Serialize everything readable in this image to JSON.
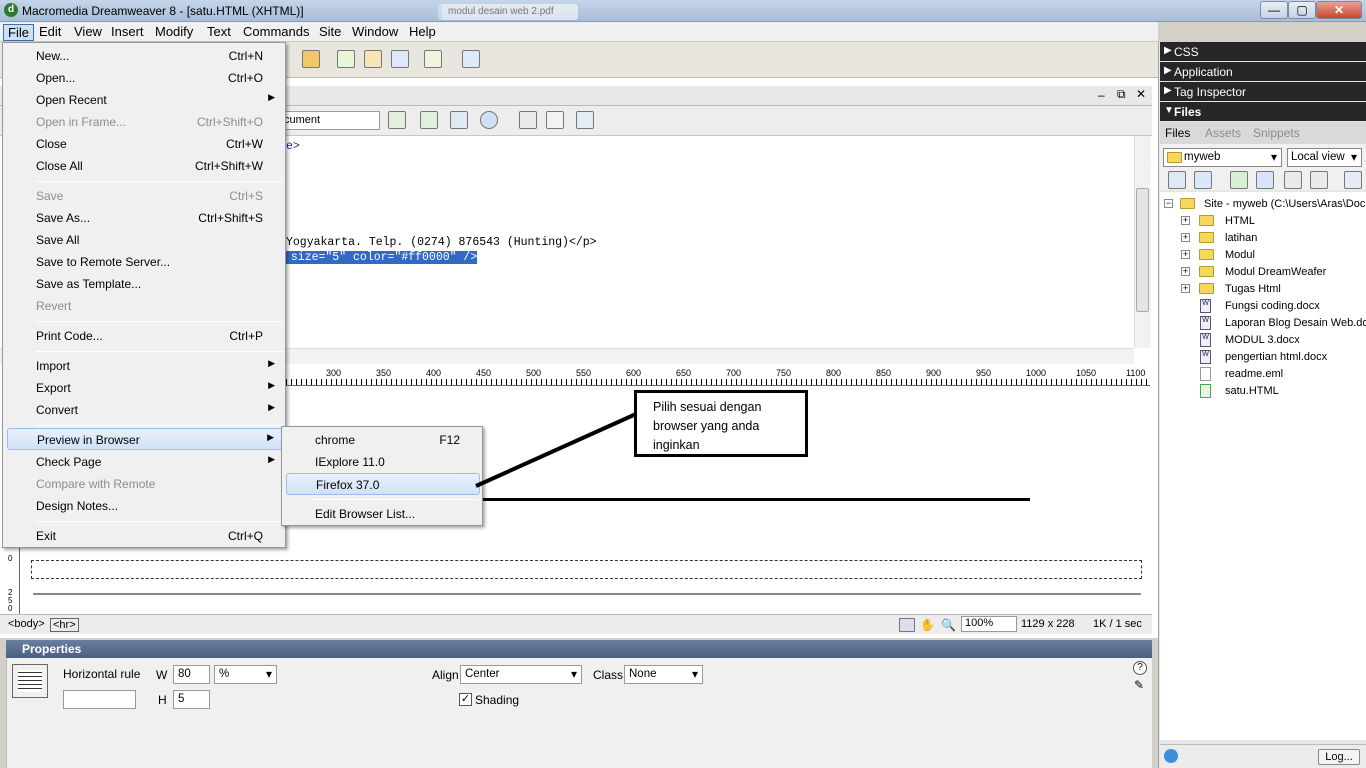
{
  "window": {
    "title": "Macromedia Dreamweaver 8 - [satu.HTML (XHTML)]",
    "bg_tab_1": "",
    "bg_tab_2": "modul desain web 2.pdf",
    "minimize": "—",
    "maximize": "▢",
    "close": "✕"
  },
  "menubar": [
    "File",
    "Edit",
    "View",
    "Insert",
    "Modify",
    "Text",
    "Commands",
    "Site",
    "Window",
    "Help"
  ],
  "document": {
    "title_value": "cument",
    "code_lines": [
      {
        "text": "e>"
      },
      {
        "text": "Yogyakarta. Telp. (0274) 876543 (Hunting)</p>"
      },
      {
        "text": " size=\"5\" color=\"#ff0000\" />"
      }
    ],
    "ruler_labels": [
      "300",
      "350",
      "400",
      "450",
      "500",
      "550",
      "600",
      "650",
      "700",
      "750",
      "800",
      "850",
      "900",
      "950",
      "1000",
      "1050",
      "1100"
    ],
    "vruler": [
      "0",
      "2",
      "5",
      "0"
    ]
  },
  "statusbar": {
    "tag_body": "<body>",
    "tag_hr": "<hr>",
    "zoom": "100%",
    "size": "1129 x 228",
    "download": "1K / 1 sec"
  },
  "properties": {
    "header": "Properties",
    "element": "Horizontal rule",
    "w_label": "W",
    "w_value": "80",
    "w_unit": "%",
    "h_label": "H",
    "h_value": "5",
    "align_label": "Align",
    "align_value": "Center",
    "class_label": "Class",
    "class_value": "None",
    "shading_label": "Shading",
    "shading_checked": "✓",
    "help": "?"
  },
  "file_menu": {
    "items": [
      {
        "label": "New...",
        "shortcut": "Ctrl+N",
        "disabled": false,
        "submenu": false
      },
      {
        "label": "Open...",
        "shortcut": "Ctrl+O",
        "disabled": false,
        "submenu": false
      },
      {
        "label": "Open Recent",
        "shortcut": "",
        "disabled": false,
        "submenu": true
      },
      {
        "label": "Open in Frame...",
        "shortcut": "Ctrl+Shift+O",
        "disabled": true,
        "submenu": false
      },
      {
        "label": "Close",
        "shortcut": "Ctrl+W",
        "disabled": false,
        "submenu": false
      },
      {
        "label": "Close All",
        "shortcut": "Ctrl+Shift+W",
        "disabled": false,
        "submenu": false
      },
      {
        "label": "Save",
        "shortcut": "Ctrl+S",
        "disabled": true,
        "submenu": false
      },
      {
        "label": "Save As...",
        "shortcut": "Ctrl+Shift+S",
        "disabled": false,
        "submenu": false
      },
      {
        "label": "Save All",
        "shortcut": "",
        "disabled": false,
        "submenu": false
      },
      {
        "label": "Save to Remote Server...",
        "shortcut": "",
        "disabled": false,
        "submenu": false
      },
      {
        "label": "Save as Template...",
        "shortcut": "",
        "disabled": false,
        "submenu": false
      },
      {
        "label": "Revert",
        "shortcut": "",
        "disabled": true,
        "submenu": false
      },
      {
        "label": "Print Code...",
        "shortcut": "Ctrl+P",
        "disabled": false,
        "submenu": false
      },
      {
        "label": "Import",
        "shortcut": "",
        "disabled": false,
        "submenu": true
      },
      {
        "label": "Export",
        "shortcut": "",
        "disabled": false,
        "submenu": true
      },
      {
        "label": "Convert",
        "shortcut": "",
        "disabled": false,
        "submenu": true
      },
      {
        "label": "Preview in Browser",
        "shortcut": "",
        "disabled": false,
        "submenu": true
      },
      {
        "label": "Check Page",
        "shortcut": "",
        "disabled": false,
        "submenu": true
      },
      {
        "label": "Compare with Remote",
        "shortcut": "",
        "disabled": true,
        "submenu": false
      },
      {
        "label": "Design Notes...",
        "shortcut": "",
        "disabled": false,
        "submenu": false
      },
      {
        "label": "Exit",
        "shortcut": "Ctrl+Q",
        "disabled": false,
        "submenu": false
      }
    ]
  },
  "browser_menu": {
    "items": [
      {
        "label": "chrome",
        "shortcut": "F12"
      },
      {
        "label": "IExplore 11.0",
        "shortcut": ""
      },
      {
        "label": "Firefox 37.0",
        "shortcut": ""
      },
      {
        "label": "Edit Browser List...",
        "shortcut": ""
      }
    ]
  },
  "annotation": {
    "line1": "Pilih sesuai dengan",
    "line2": "browser yang anda",
    "line3": "inginkan"
  },
  "right_panel": {
    "panels": [
      "CSS",
      "Application",
      "Tag Inspector",
      "Files"
    ],
    "tabs": [
      "Files",
      "Assets",
      "Snippets"
    ],
    "site": "myweb",
    "view": "Local view",
    "tree_root": "Site - myweb (C:\\Users\\Aras\\Doc",
    "folders": [
      "HTML",
      "latihan",
      "Modul",
      "Modul DreamWeafer",
      "Tugas Html"
    ],
    "files": [
      "Fungsi coding.docx",
      "Laporan Blog Desain Web.do",
      "MODUL 3.docx",
      "pengertian html.docx",
      "readme.eml",
      "satu.HTML"
    ],
    "log_button": "Log..."
  },
  "colors": {
    "highlight": "#316ac5",
    "panel_header": "#262626",
    "props_header": "#4b5f80",
    "code_tag": "#1b1bc8"
  }
}
